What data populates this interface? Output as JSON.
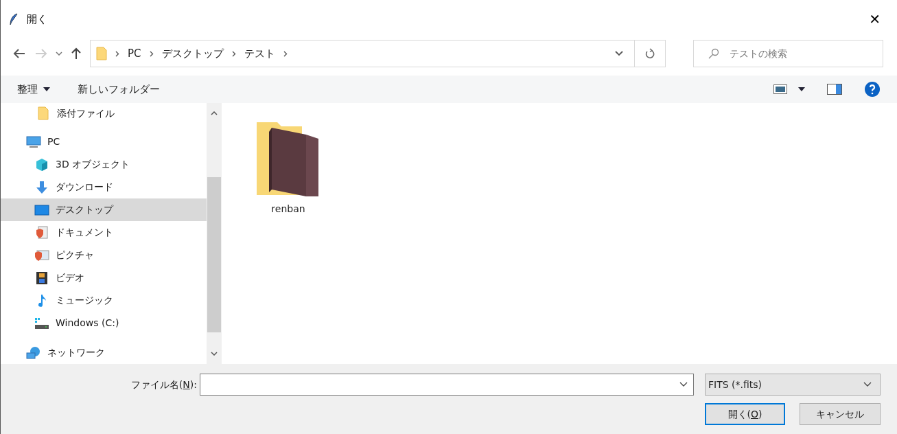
{
  "window": {
    "title": "開く",
    "close": "✕"
  },
  "nav": {
    "back_disabled": false,
    "forward_disabled": true,
    "breadcrumbs": [
      "PC",
      "デスクトップ",
      "テスト"
    ],
    "search": {
      "placeholder": "テストの検索"
    }
  },
  "toolbar": {
    "organize": "整理",
    "new_folder": "新しいフォルダー"
  },
  "sidebar": {
    "continued_children": [
      {
        "label": "添付ファイル",
        "kind": "folder",
        "selected": false
      }
    ],
    "items": [
      {
        "label": "PC",
        "kind": "pc",
        "selected": false,
        "children": [
          {
            "label": "3D オブジェクト",
            "kind": "cube",
            "selected": false
          },
          {
            "label": "ダウンロード",
            "kind": "download",
            "selected": false
          },
          {
            "label": "デスクトップ",
            "kind": "desktop",
            "selected": true
          },
          {
            "label": "ドキュメント",
            "kind": "document",
            "selected": false
          },
          {
            "label": "ピクチャ",
            "kind": "pictures",
            "selected": false
          },
          {
            "label": "ビデオ",
            "kind": "video",
            "selected": false
          },
          {
            "label": "ミュージック",
            "kind": "music",
            "selected": false
          },
          {
            "label": "Windows (C:)",
            "kind": "drive",
            "selected": false
          }
        ]
      },
      {
        "label": "ネットワーク",
        "kind": "network",
        "selected": false
      }
    ]
  },
  "files": [
    {
      "name": "renban",
      "kind": "folder"
    }
  ],
  "footer": {
    "filename": {
      "label_before": "ファイル名(",
      "access_key": "N",
      "label_after": "):"
    },
    "filter": "FITS (*.fits)",
    "open": {
      "label_before": "開く(",
      "access_key": "O",
      "label_after": ")"
    },
    "cancel": "キャンセル"
  }
}
